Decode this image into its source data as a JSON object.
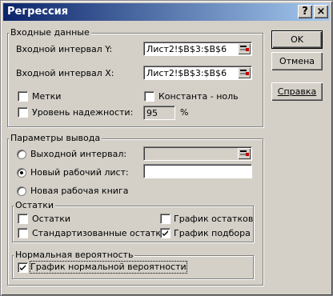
{
  "title": "Регрессия",
  "titlebar": {
    "help": "?",
    "close": "×"
  },
  "input_group": {
    "label": "Входные данные",
    "y_label": "Входной интервал Y:",
    "y_value": "Лист2!$B$3:$B$6",
    "x_label": "Входной интервал X:",
    "x_value": "Лист2!$B$3:$B$6",
    "labels_cb": {
      "label": "Метки",
      "checked": false
    },
    "const_cb": {
      "label": "Константа - ноль",
      "checked": false
    },
    "confidence_cb": {
      "label": "Уровень надежности:",
      "checked": false
    },
    "confidence_value": "95",
    "confidence_unit": "%"
  },
  "output_group": {
    "label": "Параметры вывода",
    "output_range_label": "Выходной интервал:",
    "output_range_value": "",
    "new_sheet_label": "Новый рабочий лист:",
    "new_sheet_value": "",
    "new_book_label": "Новая рабочая книга",
    "selected": "new_sheet"
  },
  "residuals_group": {
    "label": "Остатки",
    "residuals": {
      "label": "Остатки",
      "checked": false
    },
    "std_residuals": {
      "label": "Стандартизованные остатки",
      "checked": false
    },
    "residual_plot": {
      "label": "График остатков",
      "checked": false
    },
    "fit_plot": {
      "label": "График подбора",
      "checked": true
    }
  },
  "normal_group": {
    "label": "Нормальная вероятность",
    "normal_plot": {
      "label": "График нормальной вероятности",
      "checked": true
    }
  },
  "buttons": {
    "ok": "OK",
    "cancel": "Отмена",
    "help": "Справка"
  }
}
